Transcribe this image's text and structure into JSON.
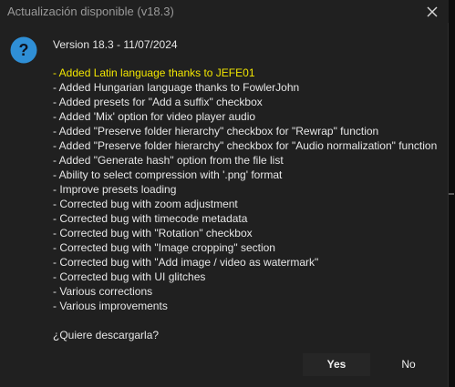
{
  "window": {
    "title": "Actualización disponible (v18.3)",
    "close_icon": "close-icon"
  },
  "dialog": {
    "icon": "question-icon",
    "icon_color": "#2f8fd6",
    "version_line": "Version 18.3 - 11/07/2024",
    "highlight_color": "#f2e600",
    "changes": [
      "- Added Latin language thanks to JEFE01",
      "- Added Hungarian language thanks to FowlerJohn",
      "- Added presets for \"Add a suffix\" checkbox",
      "- Added 'Mix' option for video player audio",
      "- Added \"Preserve folder hierarchy\" checkbox for \"Rewrap\" function",
      "- Added \"Preserve folder hierarchy\" checkbox for \"Audio normalization\" function",
      "- Added \"Generate hash\" option from the file list",
      "- Ability to select compression with '.png' format",
      "- Improve presets loading",
      "- Corrected bug with zoom adjustment",
      "- Corrected bug with timecode metadata",
      "- Corrected bug with \"Rotation\" checkbox",
      "- Corrected bug with \"Image cropping\" section",
      "- Corrected bug with \"Add image / video as watermark\"",
      "- Corrected bug with UI glitches",
      "- Various corrections",
      "- Various improvements"
    ],
    "question": "¿Quiere descargarla?"
  },
  "buttons": {
    "yes_label": "Yes",
    "no_label": "No"
  }
}
